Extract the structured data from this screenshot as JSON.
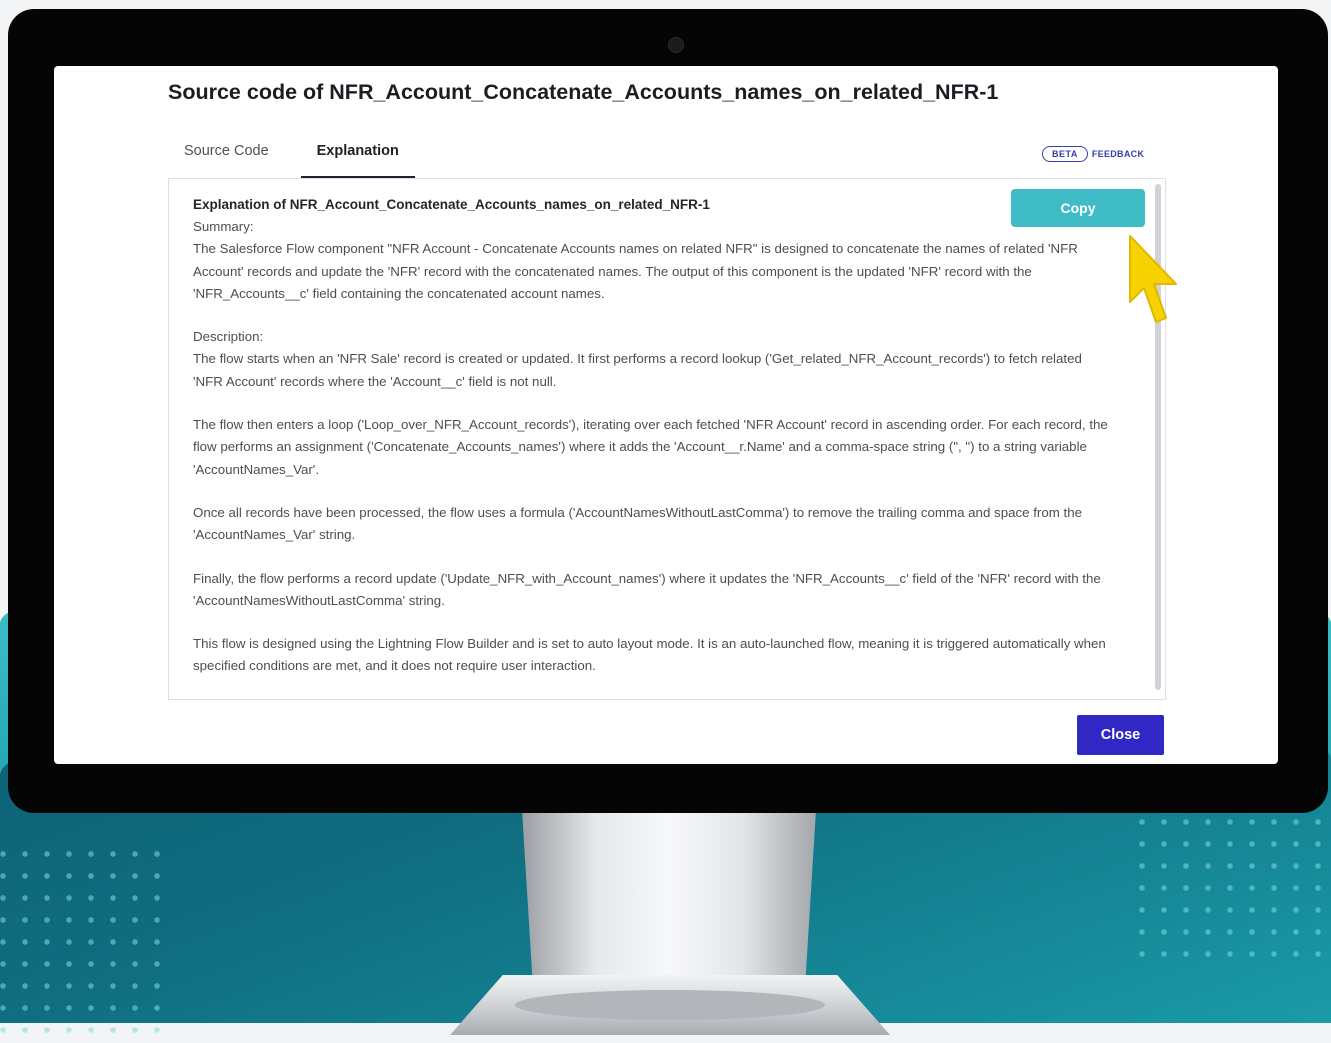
{
  "modal": {
    "title": "Source code of NFR_Account_Concatenate_Accounts_names_on_related_NFR-1",
    "tabs": [
      {
        "label": "Source Code",
        "active": false
      },
      {
        "label": "Explanation",
        "active": true
      }
    ],
    "beta_label": "BETA",
    "feedback_label": "FEEDBACK",
    "copy_label": "Copy",
    "close_label": "Close"
  },
  "explanation": {
    "heading": "Explanation of NFR_Account_Concatenate_Accounts_names_on_related_NFR-1",
    "summary_label": "Summary:",
    "summary": "The Salesforce Flow component \"NFR Account - Concatenate Accounts names on related NFR\" is designed to concatenate the names of related 'NFR Account' records and update the 'NFR' record with the concatenated names. The output of this component is the updated 'NFR' record with the 'NFR_Accounts__c' field containing the concatenated account names.",
    "description_label": "Description:",
    "paragraphs": [
      "The flow starts when an 'NFR Sale' record is created or updated. It first performs a record lookup ('Get_related_NFR_Account_records') to fetch related 'NFR Account' records where the 'Account__c' field is not null.",
      "The flow then enters a loop ('Loop_over_NFR_Account_records'), iterating over each fetched 'NFR Account' record in ascending order. For each record, the flow performs an assignment ('Concatenate_Accounts_names') where it adds the 'Account__r.Name' and a comma-space string (\", \") to a string variable 'AccountNames_Var'.",
      "Once all records have been processed, the flow uses a formula ('AccountNamesWithoutLastComma') to remove the trailing comma and space from the 'AccountNames_Var' string.",
      "Finally, the flow performs a record update ('Update_NFR_with_Account_names') where it updates the 'NFR_Accounts__c' field of the 'NFR' record with the 'AccountNamesWithoutLastComma' string.",
      "This flow is designed using the Lightning Flow Builder and is set to auto layout mode. It is an auto-launched flow, meaning it is triggered automatically when specified conditions are met, and it does not require user interaction."
    ]
  },
  "colors": {
    "accent_copy": "#3fbcc6",
    "close_button": "#3127c4",
    "beta": "#3440a8",
    "cursor": "#f5d200"
  },
  "icons": [
    "cursor-pointer-icon",
    "webcam-icon"
  ]
}
